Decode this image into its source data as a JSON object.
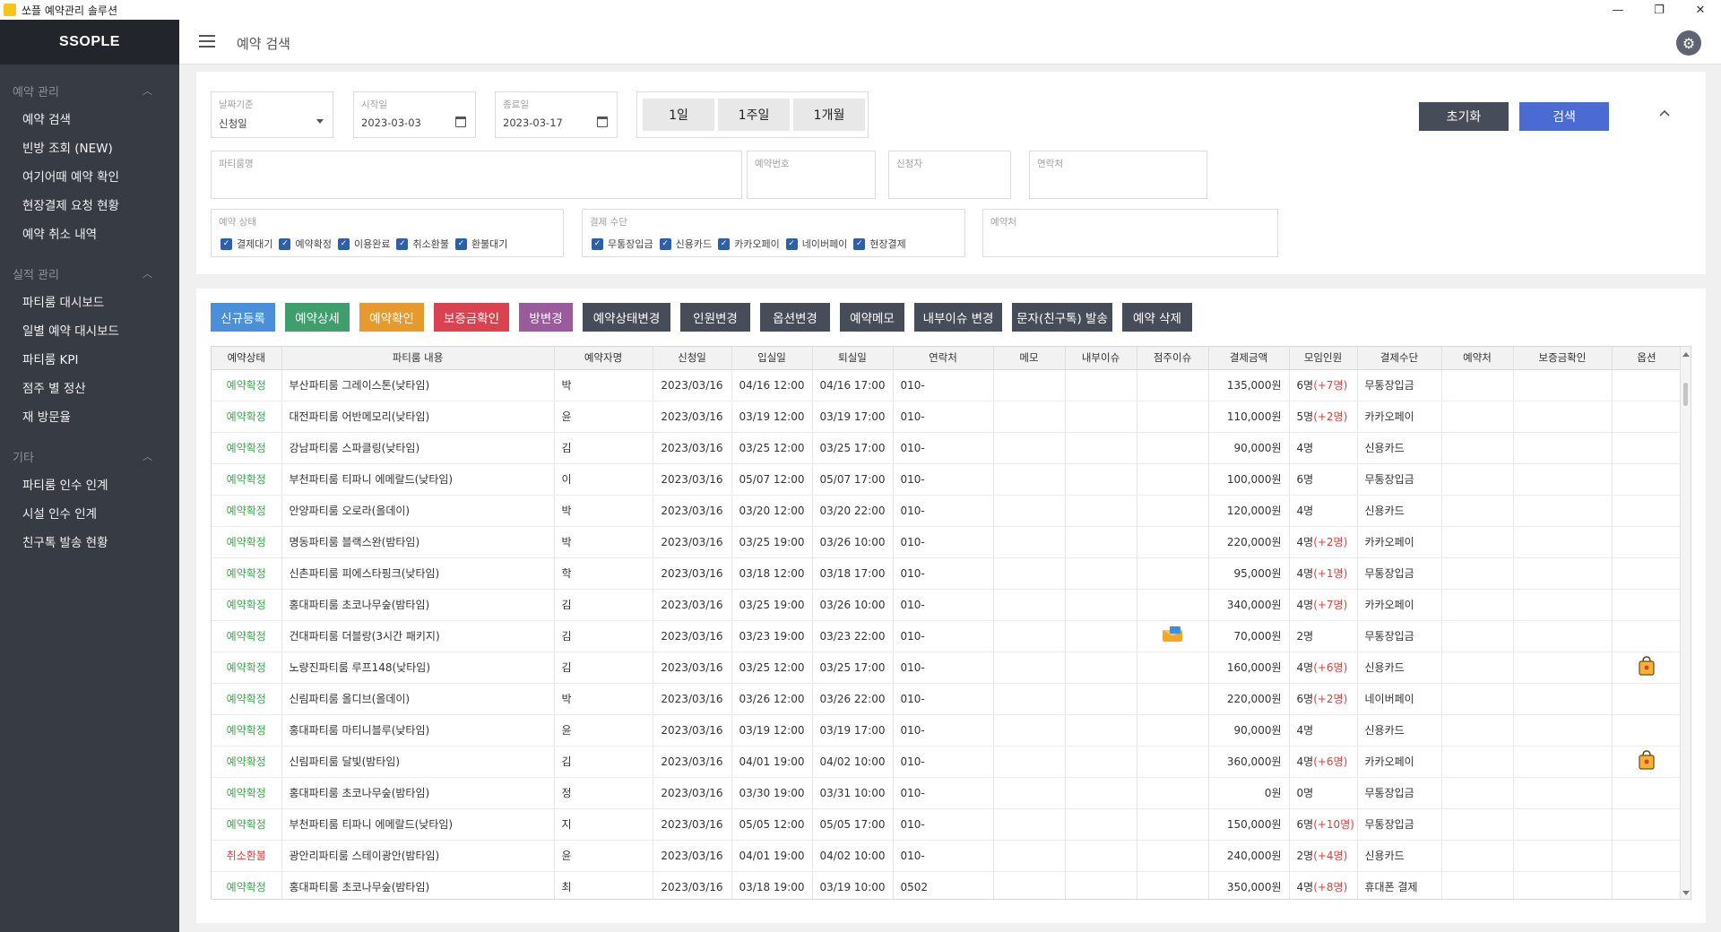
{
  "window": {
    "title": "쏘플 예약관리 솔루션",
    "minimize": "—",
    "maximize": "❐",
    "close": "✕"
  },
  "sidebar": {
    "brand": "SSOPLE",
    "sections": [
      {
        "title": "예약 관리",
        "items": [
          "예약 검색",
          "빈방 조회 (NEW)",
          "여기어때 예약 확인",
          "현장결제 요청 현황",
          "예약 취소 내역"
        ]
      },
      {
        "title": "실적 관리",
        "items": [
          "파티룸 대시보드",
          "일별 예약 대시보드",
          "파티룸 KPI",
          "점주 별 정산",
          "재 방문율"
        ]
      },
      {
        "title": "기타",
        "items": [
          "파티룸 인수 인계",
          "시설 인수 인계",
          "친구톡 발송 현황"
        ]
      }
    ]
  },
  "header": {
    "page_title": "예약 검색"
  },
  "search": {
    "date_basis": {
      "label": "날짜기준",
      "value": "신청일"
    },
    "start_date": {
      "label": "시작일",
      "value": "2023-03-03"
    },
    "end_date": {
      "label": "종료일",
      "value": "2023-03-17"
    },
    "range_buttons": [
      "1일",
      "1주일",
      "1개월"
    ],
    "reset_label": "초기화",
    "search_label": "검색",
    "partyroom_label": "파티룸명",
    "reservation_no_label": "예약번호",
    "applicant_label": "신청자",
    "contact_label": "연락처",
    "status_group": {
      "label": "예약 상태",
      "options": [
        "결제대기",
        "예약확정",
        "이용완료",
        "취소환불",
        "환불대기"
      ]
    },
    "payment_group": {
      "label": "결제 수단",
      "options": [
        "무통장입금",
        "신용카드",
        "카카오페이",
        "네이버페이",
        "현장결제"
      ]
    },
    "source_label": "예약처"
  },
  "actions": [
    {
      "label": "신규등록",
      "color": "#4a8fd8"
    },
    {
      "label": "예약상세",
      "color": "#3f9e6c"
    },
    {
      "label": "예약확인",
      "color": "#e49a2d"
    },
    {
      "label": "보증금확인",
      "color": "#d9434f"
    },
    {
      "label": "방변경",
      "color": "#9a5a9c"
    },
    {
      "label": "예약상태변경",
      "color": "#474c59"
    },
    {
      "label": "인원변경",
      "color": "#474c59"
    },
    {
      "label": "옵션변경",
      "color": "#474c59"
    },
    {
      "label": "예약메모",
      "color": "#474c59"
    },
    {
      "label": "내부이슈 변경",
      "color": "#474c59"
    },
    {
      "label": "문자(친구톡) 발송",
      "color": "#474c59"
    },
    {
      "label": "예약 삭제",
      "color": "#474c59"
    }
  ],
  "table": {
    "columns": [
      "예약상태",
      "파티룸 내용",
      "예약자명",
      "신청일",
      "입실일",
      "퇴실일",
      "연락처",
      "메모",
      "내부이슈",
      "점주이슈",
      "결제금액",
      "모임인원",
      "결제수단",
      "예약처",
      "보증금확인",
      "옵션"
    ],
    "rows": [
      {
        "status": "예약확정",
        "room": "부산파티룸 그레이스톤(낮타임)",
        "name": "박",
        "applied": "2023/03/16",
        "checkin": "04/16 12:00",
        "checkout": "04/16 17:00",
        "phone": "010-",
        "owner_icon": "",
        "amount": "135,000원",
        "people": "6명",
        "extra": "(+7명)",
        "payment": "무통장입금",
        "option_icon": ""
      },
      {
        "status": "예약확정",
        "room": "대전파티룸 어반메모리(낮타임)",
        "name": "윤",
        "applied": "2023/03/16",
        "checkin": "03/19 12:00",
        "checkout": "03/19 17:00",
        "phone": "010-",
        "owner_icon": "",
        "amount": "110,000원",
        "people": "5명",
        "extra": "(+2명)",
        "payment": "카카오페이",
        "option_icon": ""
      },
      {
        "status": "예약확정",
        "room": "강남파티룸 스파클링(낮타임)",
        "name": "김",
        "applied": "2023/03/16",
        "checkin": "03/25 12:00",
        "checkout": "03/25 17:00",
        "phone": "010-",
        "owner_icon": "",
        "amount": "90,000원",
        "people": "4명",
        "extra": "",
        "payment": "신용카드",
        "option_icon": ""
      },
      {
        "status": "예약확정",
        "room": "부천파티룸 티파니 에메랄드(낮타임)",
        "name": "이",
        "applied": "2023/03/16",
        "checkin": "05/07 12:00",
        "checkout": "05/07 17:00",
        "phone": "010-",
        "owner_icon": "",
        "amount": "100,000원",
        "people": "6명",
        "extra": "",
        "payment": "무통장입금",
        "option_icon": ""
      },
      {
        "status": "예약확정",
        "room": "안양파티룸 오로라(올데이)",
        "name": "박",
        "applied": "2023/03/16",
        "checkin": "03/20 12:00",
        "checkout": "03/20 22:00",
        "phone": "010-",
        "owner_icon": "",
        "amount": "120,000원",
        "people": "4명",
        "extra": "",
        "payment": "신용카드",
        "option_icon": ""
      },
      {
        "status": "예약확정",
        "room": "명동파티룸 블랙스완(밤타임)",
        "name": "박",
        "applied": "2023/03/16",
        "checkin": "03/25 19:00",
        "checkout": "03/26 10:00",
        "phone": "010-",
        "owner_icon": "",
        "amount": "220,000원",
        "people": "4명",
        "extra": "(+2명)",
        "payment": "카카오페이",
        "option_icon": ""
      },
      {
        "status": "예약확정",
        "room": "신촌파티룸 피에스타핑크(낮타임)",
        "name": "학",
        "applied": "2023/03/16",
        "checkin": "03/18 12:00",
        "checkout": "03/18 17:00",
        "phone": "010-",
        "owner_icon": "",
        "amount": "95,000원",
        "people": "4명",
        "extra": "(+1명)",
        "payment": "무통장입금",
        "option_icon": ""
      },
      {
        "status": "예약확정",
        "room": "홍대파티룸 초코나무숲(밤타임)",
        "name": "김",
        "applied": "2023/03/16",
        "checkin": "03/25 19:00",
        "checkout": "03/26 10:00",
        "phone": "010-",
        "owner_icon": "",
        "amount": "340,000원",
        "people": "4명",
        "extra": "(+7명)",
        "payment": "카카오페이",
        "option_icon": ""
      },
      {
        "status": "예약확정",
        "room": "건대파티룸 더블랑(3시간 패키지)",
        "name": "김",
        "applied": "2023/03/16",
        "checkin": "03/23 19:00",
        "checkout": "03/23 22:00",
        "phone": "010-",
        "owner_icon": "mail-icon",
        "amount": "70,000원",
        "people": "2명",
        "extra": "",
        "payment": "무통장입금",
        "option_icon": ""
      },
      {
        "status": "예약확정",
        "room": "노량진파티룸 루프148(낮타임)",
        "name": "김",
        "applied": "2023/03/16",
        "checkin": "03/25 12:00",
        "checkout": "03/25 17:00",
        "phone": "010-",
        "owner_icon": "",
        "amount": "160,000원",
        "people": "4명",
        "extra": "(+6명)",
        "payment": "신용카드",
        "option_icon": "bag-icon"
      },
      {
        "status": "예약확정",
        "room": "신림파티룸 올디브(올데이)",
        "name": "박",
        "applied": "2023/03/16",
        "checkin": "03/26 12:00",
        "checkout": "03/26 22:00",
        "phone": "010-",
        "owner_icon": "",
        "amount": "220,000원",
        "people": "6명",
        "extra": "(+2명)",
        "payment": "네이버페이",
        "option_icon": ""
      },
      {
        "status": "예약확정",
        "room": "홍대파티룸 마티니블루(낮타임)",
        "name": "윤",
        "applied": "2023/03/16",
        "checkin": "03/19 12:00",
        "checkout": "03/19 17:00",
        "phone": "010-",
        "owner_icon": "",
        "amount": "90,000원",
        "people": "4명",
        "extra": "",
        "payment": "신용카드",
        "option_icon": ""
      },
      {
        "status": "예약확정",
        "room": "신림파티룸 달빛(밤타임)",
        "name": "김",
        "applied": "2023/03/16",
        "checkin": "04/01 19:00",
        "checkout": "04/02 10:00",
        "phone": "010-",
        "owner_icon": "",
        "amount": "360,000원",
        "people": "4명",
        "extra": "(+6명)",
        "payment": "카카오페이",
        "option_icon": "bag-icon"
      },
      {
        "status": "예약확정",
        "room": "홍대파티룸 초코나무숲(밤타임)",
        "name": "정",
        "applied": "2023/03/16",
        "checkin": "03/30 19:00",
        "checkout": "03/31 10:00",
        "phone": "010-",
        "owner_icon": "",
        "amount": "0원",
        "people": "0명",
        "extra": "",
        "payment": "무통장입금",
        "option_icon": ""
      },
      {
        "status": "예약확정",
        "room": "부천파티룸 티파니 에메랄드(낮타임)",
        "name": "지",
        "applied": "2023/03/16",
        "checkin": "05/05 12:00",
        "checkout": "05/05 17:00",
        "phone": "010-",
        "owner_icon": "",
        "amount": "150,000원",
        "people": "6명",
        "extra": "(+10명)",
        "payment": "무통장입금",
        "option_icon": ""
      },
      {
        "status": "취소환불",
        "room": "광안리파티룸 스테이광안(밤타임)",
        "name": "윤",
        "applied": "2023/03/16",
        "checkin": "04/01 19:00",
        "checkout": "04/02 10:00",
        "phone": "010-",
        "owner_icon": "",
        "amount": "240,000원",
        "people": "2명",
        "extra": "(+4명)",
        "payment": "신용카드",
        "option_icon": ""
      },
      {
        "status": "예약확정",
        "room": "홍대파티룸 초코나무숲(밤타임)",
        "name": "최",
        "applied": "2023/03/16",
        "checkin": "03/18 19:00",
        "checkout": "03/19 10:00",
        "phone": "0502",
        "owner_icon": "",
        "amount": "350,000원",
        "people": "4명",
        "extra": "(+8명)",
        "payment": "휴대폰 결제",
        "option_icon": ""
      }
    ]
  },
  "colors": {
    "sidebar_bg": "#363b44",
    "brand_bg": "#22262c",
    "status_ok": "#3aa84b",
    "status_cancel": "#e03b3b",
    "primary": "#4a6ad4"
  }
}
